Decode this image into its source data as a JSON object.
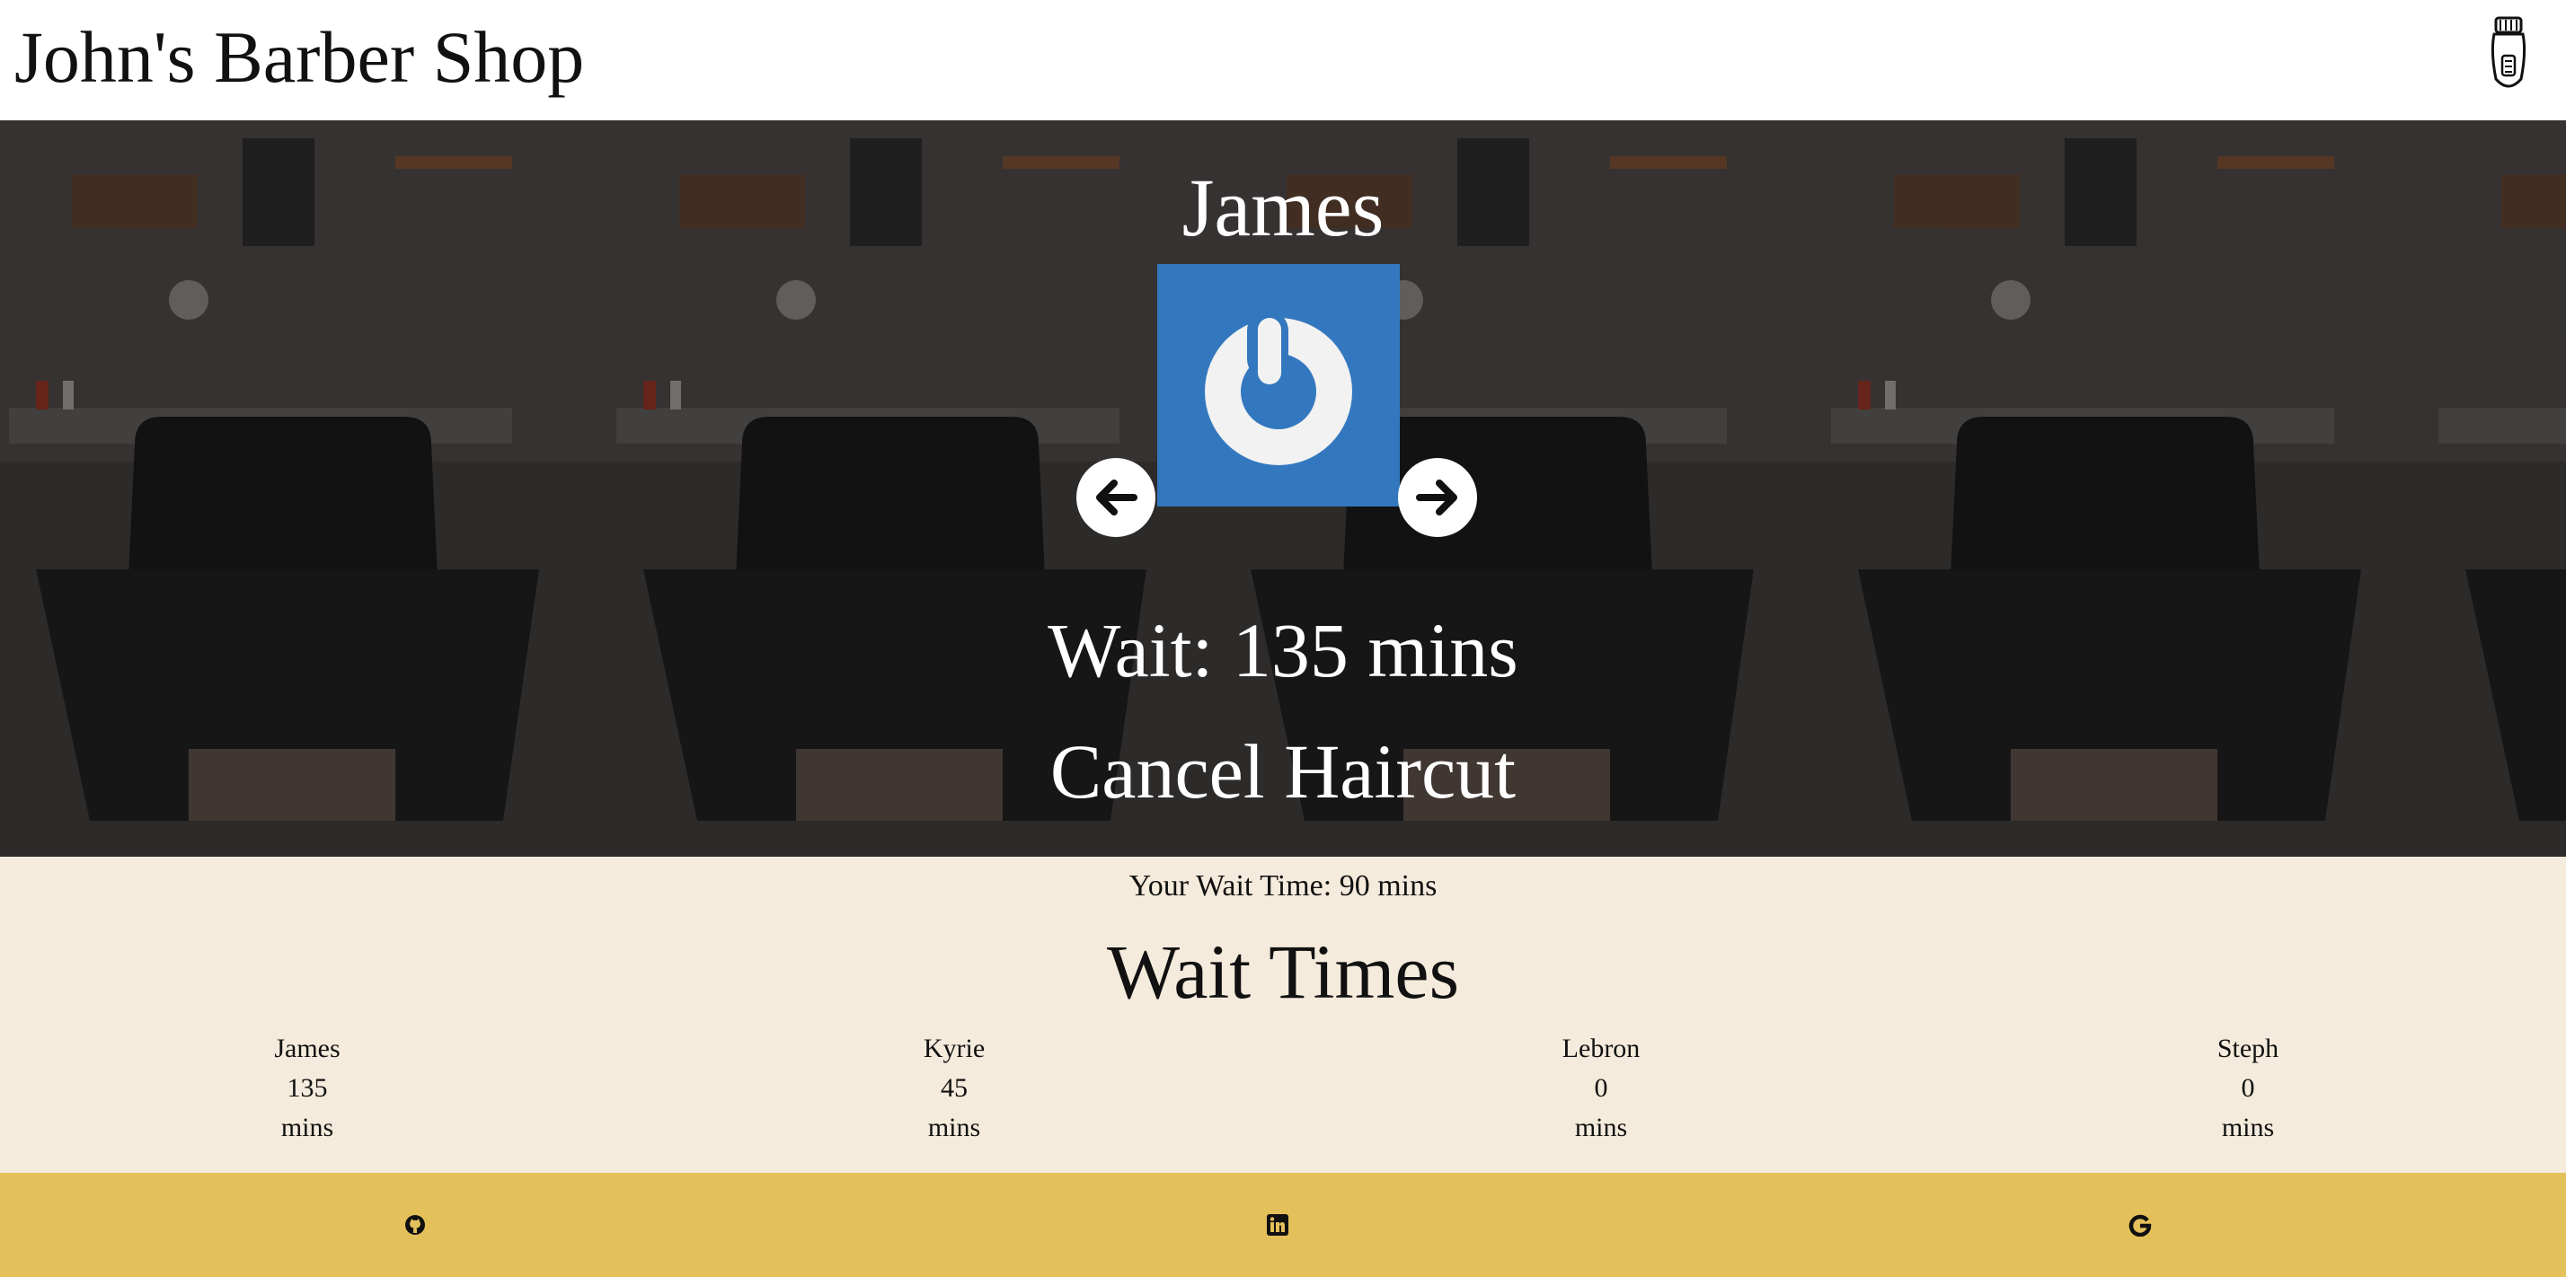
{
  "header": {
    "brand": "John's Barber Shop",
    "icon": "hair-clipper-icon"
  },
  "hero": {
    "barber_name": "James",
    "avatar_icon": "power-icon",
    "avatar_color": "#3378bf",
    "prev_icon": "arrow-left-icon",
    "next_icon": "arrow-right-icon",
    "wait_text": "Wait: 135 mins",
    "cancel_label": "Cancel Haircut"
  },
  "info": {
    "your_wait": "Your Wait Time: 90 mins",
    "title": "Wait Times",
    "barbers": [
      {
        "name": "James",
        "wait": "135",
        "unit": "mins"
      },
      {
        "name": "Kyrie",
        "wait": "45",
        "unit": "mins"
      },
      {
        "name": "Lebron",
        "wait": "0",
        "unit": "mins"
      },
      {
        "name": "Steph",
        "wait": "0",
        "unit": "mins"
      }
    ]
  },
  "footer": {
    "links": [
      "github-icon",
      "linkedin-icon",
      "google-icon"
    ],
    "color": "#e4c05b"
  }
}
